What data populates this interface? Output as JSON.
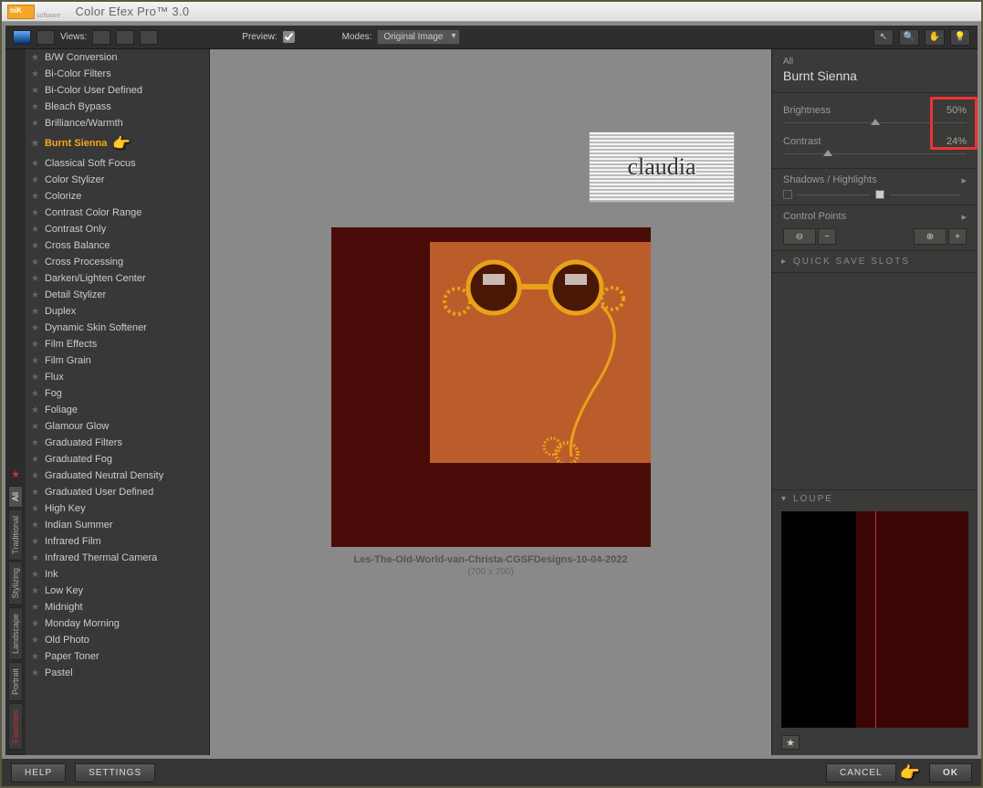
{
  "app_title": "Color Efex Pro™ 3.0",
  "topbar": {
    "views": "Views:",
    "preview": "Preview:",
    "preview_checked": true,
    "modes": "Modes:",
    "mode_select": "Original Image"
  },
  "categories": [
    "All",
    "Traditional",
    "Stylizing",
    "Landscape",
    "Portrait",
    "Favorites"
  ],
  "active_category": "All",
  "filters": [
    "B/W Conversion",
    "Bi-Color Filters",
    "Bi-Color User Defined",
    "Bleach Bypass",
    "Brilliance/Warmth",
    "Burnt Sienna",
    "Classical Soft Focus",
    "Color Stylizer",
    "Colorize",
    "Contrast Color Range",
    "Contrast Only",
    "Cross Balance",
    "Cross Processing",
    "Darken/Lighten Center",
    "Detail Stylizer",
    "Duplex",
    "Dynamic Skin Softener",
    "Film Effects",
    "Film Grain",
    "Flux",
    "Fog",
    "Foliage",
    "Glamour Glow",
    "Graduated Filters",
    "Graduated Fog",
    "Graduated Neutral Density",
    "Graduated User Defined",
    "High Key",
    "Indian Summer",
    "Infrared Film",
    "Infrared Thermal Camera",
    "Ink",
    "Low Key",
    "Midnight",
    "Monday Morning",
    "Old Photo",
    "Paper Toner",
    "Pastel"
  ],
  "selected_filter": "Burnt Sienna",
  "image": {
    "caption": "Les-The-Old-World-van-Christa-CGSFDesigns-10-04-2022",
    "dims": "(700 x 700)"
  },
  "right": {
    "scope": "All",
    "name": "Burnt Sienna",
    "brightness_label": "Brightness",
    "brightness_value": "50%",
    "contrast_label": "Contrast",
    "contrast_value": "24%",
    "sh_title": "Shadows / Highlights",
    "cp_title": "Control Points",
    "qs": "QUICK SAVE SLOTS",
    "loupe": "LOUPE"
  },
  "bottom": {
    "help": "HELP",
    "settings": "SETTINGS",
    "cancel": "CANCEL",
    "ok": "OK"
  },
  "watermark": "claudia"
}
